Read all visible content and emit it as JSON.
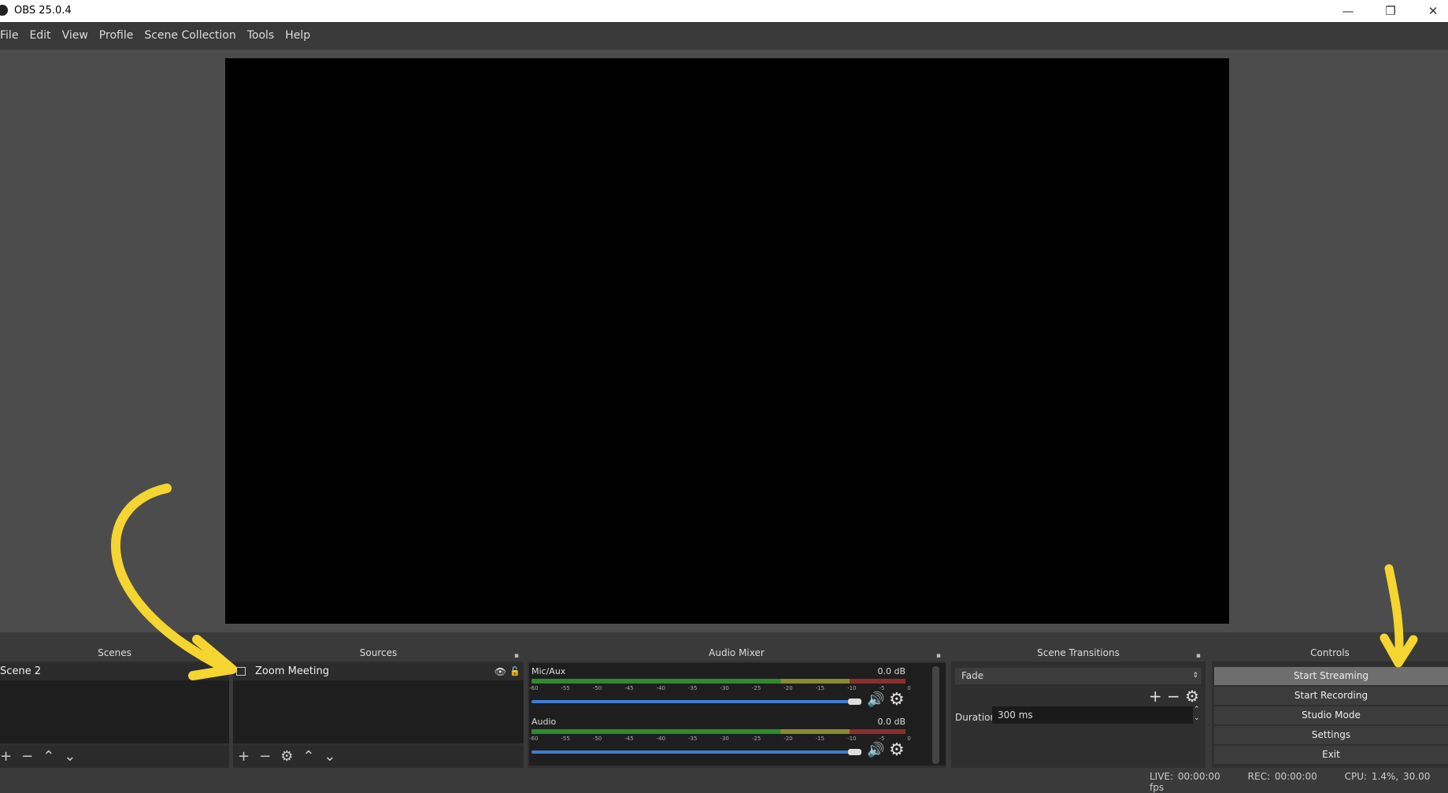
{
  "window": {
    "title": "OBS 25.0.4",
    "minimize": "—",
    "restore": "❐",
    "close": "✕"
  },
  "menu": [
    "File",
    "Edit",
    "View",
    "Profile",
    "Scene Collection",
    "Tools",
    "Help"
  ],
  "scenes": {
    "title": "Scenes",
    "items": [
      "Scene 2"
    ]
  },
  "sources": {
    "title": "Sources",
    "items": [
      {
        "name": "Zoom Meeting",
        "visible": true,
        "locked": false
      }
    ]
  },
  "mixer": {
    "title": "Audio Mixer",
    "ticks": [
      "-60",
      "-55",
      "-50",
      "-45",
      "-40",
      "-35",
      "-30",
      "-25",
      "-20",
      "-15",
      "-10",
      "-5",
      "0"
    ],
    "channels": [
      {
        "name": "Mic/Aux",
        "db": "0.0 dB",
        "volume_percent": 100
      },
      {
        "name": "Audio",
        "db": "0.0 dB",
        "volume_percent": 100
      }
    ]
  },
  "transitions": {
    "title": "Scene Transitions",
    "selected": "Fade",
    "duration_label": "Duration",
    "duration_value": "300 ms"
  },
  "controls": {
    "title": "Controls",
    "buttons": [
      "Start Streaming",
      "Start Recording",
      "Studio Mode",
      "Settings",
      "Exit"
    ]
  },
  "status": {
    "live": "LIVE: 00:00:00",
    "rec": "REC: 00:00:00",
    "cpu": "CPU: 1.4%, 30.00 fps"
  },
  "colors": {
    "annotation_arrow": "#f5d530",
    "meter_green": "#2f8a2f",
    "slider_blue": "#3d7fd1"
  }
}
